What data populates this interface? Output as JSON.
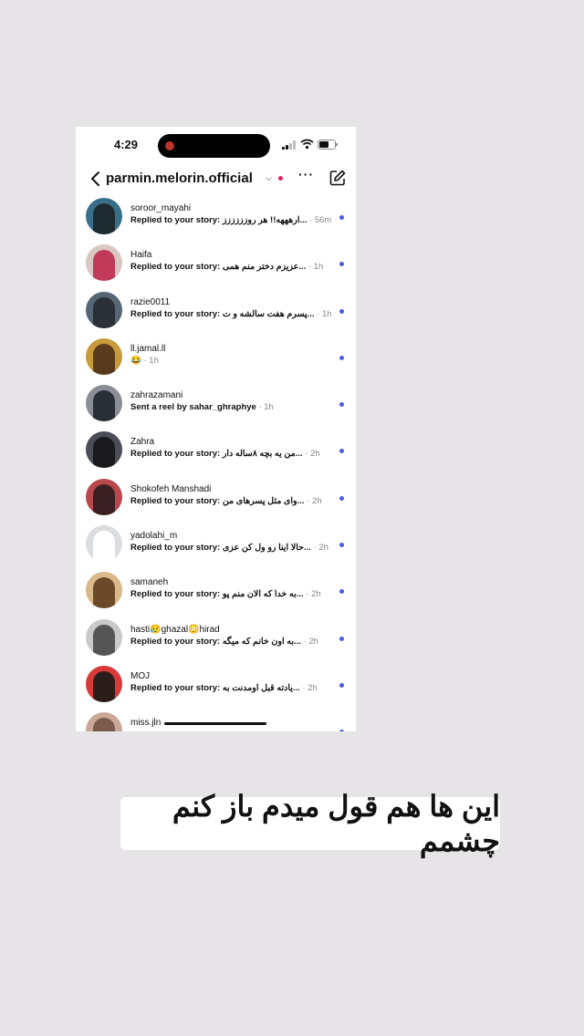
{
  "status": {
    "time": "4:29"
  },
  "header": {
    "title": "parmin.melorin.official"
  },
  "threads": [
    {
      "name": "soroor_mayahi",
      "prefix": "Replied to your story:",
      "text": "...ارهههه!! هر روزززززز",
      "time": "56m",
      "unread": true,
      "avatar_bg": "#3a6f8a",
      "avatar_fg": "#1d2b30"
    },
    {
      "name": "Haifa",
      "prefix": "Replied to your story:",
      "text": "...عزیزم دختر منم همی",
      "time": "1h",
      "unread": true,
      "avatar_bg": "#d8c7c2",
      "avatar_fg": "#c23a5a"
    },
    {
      "name": "razie0011",
      "prefix": "Replied to your story:",
      "text": "...پسرم هفت سالشه و ت",
      "time": "1h",
      "unread": true,
      "avatar_bg": "#556677",
      "avatar_fg": "#2b2f36"
    },
    {
      "name": "ll.jamal.ll",
      "prefix": "",
      "text": "😂",
      "time": "1h",
      "unread": true,
      "avatar_bg": "#c79a3b",
      "avatar_fg": "#5a3a1c"
    },
    {
      "name": "zahrazamani",
      "prefix": "Sent a reel by sahar_ghraphye",
      "text": "",
      "time": "1h",
      "unread": true,
      "avatar_bg": "#8a8f96",
      "avatar_fg": "#2a2e35"
    },
    {
      "name": "Zahra",
      "prefix": "Replied to your story:",
      "text": "...من یه بچه ۸ساله دار",
      "time": "2h",
      "unread": true,
      "avatar_bg": "#4a4d55",
      "avatar_fg": "#1a1a1c"
    },
    {
      "name": "Shokofeh Manshadi",
      "prefix": "Replied to your story:",
      "text": "...وای مثل پسرهای من",
      "time": "2h",
      "unread": true,
      "avatar_bg": "#b8484e",
      "avatar_fg": "#3a2022"
    },
    {
      "name": "yadolahi_m",
      "prefix": "Replied to your story:",
      "text": "...حالا اینا رو ول کن عزی",
      "time": "2h",
      "unread": true,
      "avatar_bg": "#dcdde0",
      "avatar_fg": "#ffffff"
    },
    {
      "name": "samaneh",
      "prefix": "Replied to your story:",
      "text": "...به خدا که الان منم پو",
      "time": "2h",
      "unread": true,
      "avatar_bg": "#d9b98a",
      "avatar_fg": "#6b4a2a"
    },
    {
      "name": "hasti😥ghazal😳hirad",
      "prefix": "Replied to your story:",
      "text": "...به اون خانم که میگه",
      "time": "2h",
      "unread": true,
      "avatar_bg": "#c9c9c9",
      "avatar_fg": "#555555"
    },
    {
      "name": "MOJ",
      "prefix": "Replied to your story:",
      "text": "...یادته قبل اومدنت به",
      "time": "2h",
      "unread": true,
      "avatar_bg": "#d83a3a",
      "avatar_fg": "#2b1d1a"
    },
    {
      "name": "miss.jln",
      "prefix": "",
      "text": "",
      "time": "",
      "unread": true,
      "avatar_bg": "#c9a89a",
      "avatar_fg": "#7a5a4a"
    }
  ],
  "caption": "این ها هم قول میدم باز کنم چشمم"
}
